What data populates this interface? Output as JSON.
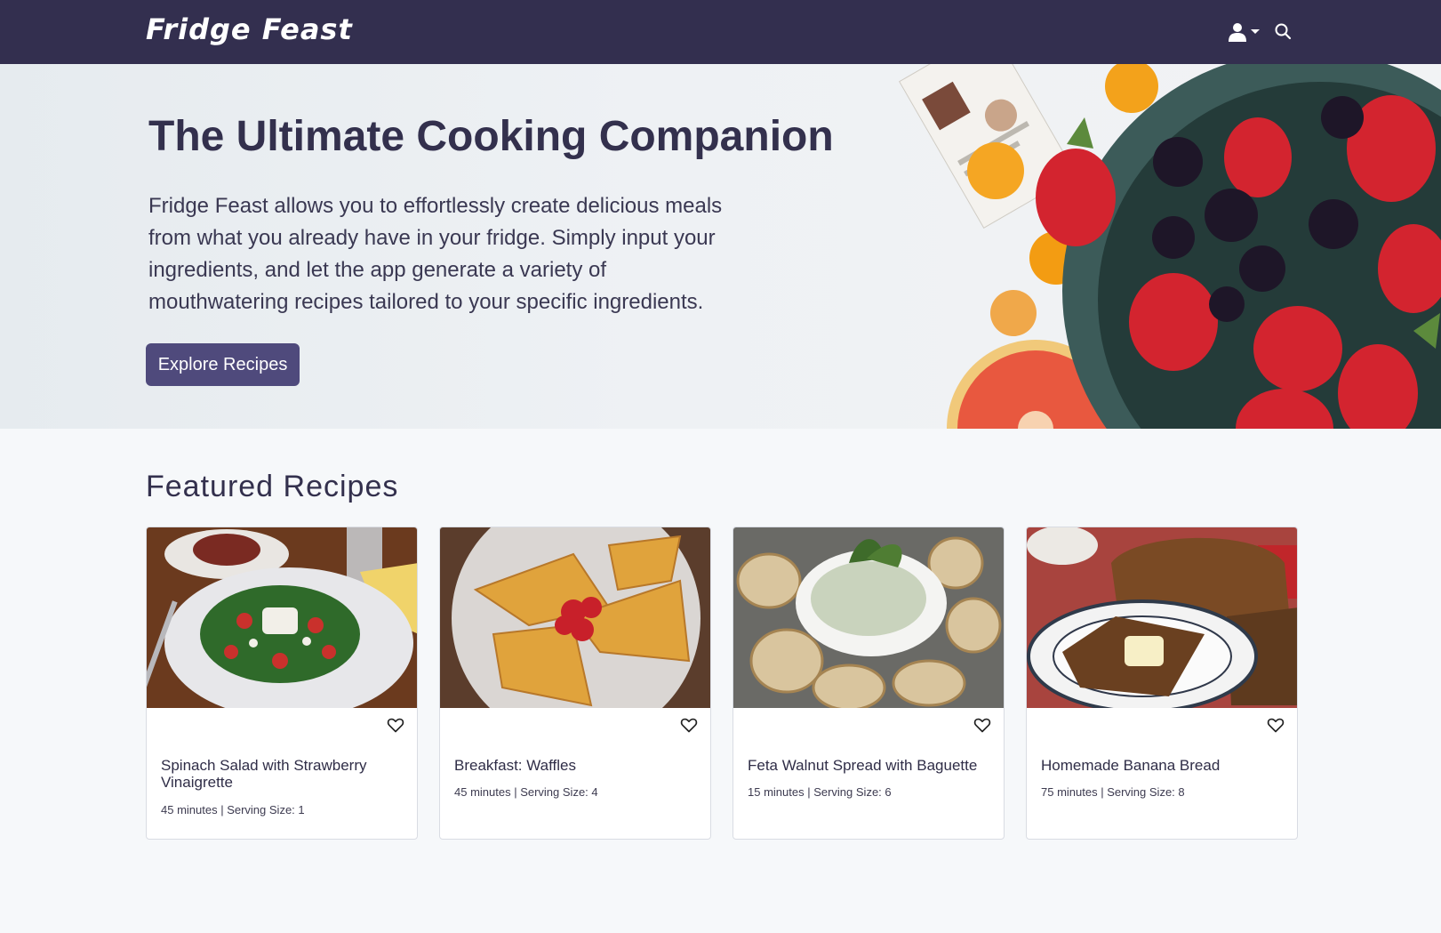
{
  "navbar": {
    "brand": "Fridge Feast",
    "user_menu_icon": "user-dropdown-icon",
    "search_icon": "search-icon",
    "background": "#332f4f"
  },
  "hero": {
    "title": "The Ultimate Cooking Companion",
    "description": "Fridge Feast allows you to effortlessly create delicious meals from what you already have in your fridge. Simply input your ingredients, and let the app generate a variety of mouthwatering recipes tailored to your specific ingredients.",
    "button_label": "Explore Recipes",
    "accent": "#4f4a7c"
  },
  "featured": {
    "title": "Featured Recipes",
    "recipes": [
      {
        "title": "Spinach Salad with Strawberry Vinaigrette",
        "meta": "45 minutes | Serving Size: 1"
      },
      {
        "title": "Breakfast: Waffles",
        "meta": "45 minutes | Serving Size: 4"
      },
      {
        "title": "Feta Walnut Spread with Baguette",
        "meta": "15 minutes | Serving Size: 6"
      },
      {
        "title": "Homemade Banana Bread",
        "meta": "75 minutes | Serving Size: 8"
      }
    ],
    "favorite_icon": "heart-outline-icon"
  }
}
